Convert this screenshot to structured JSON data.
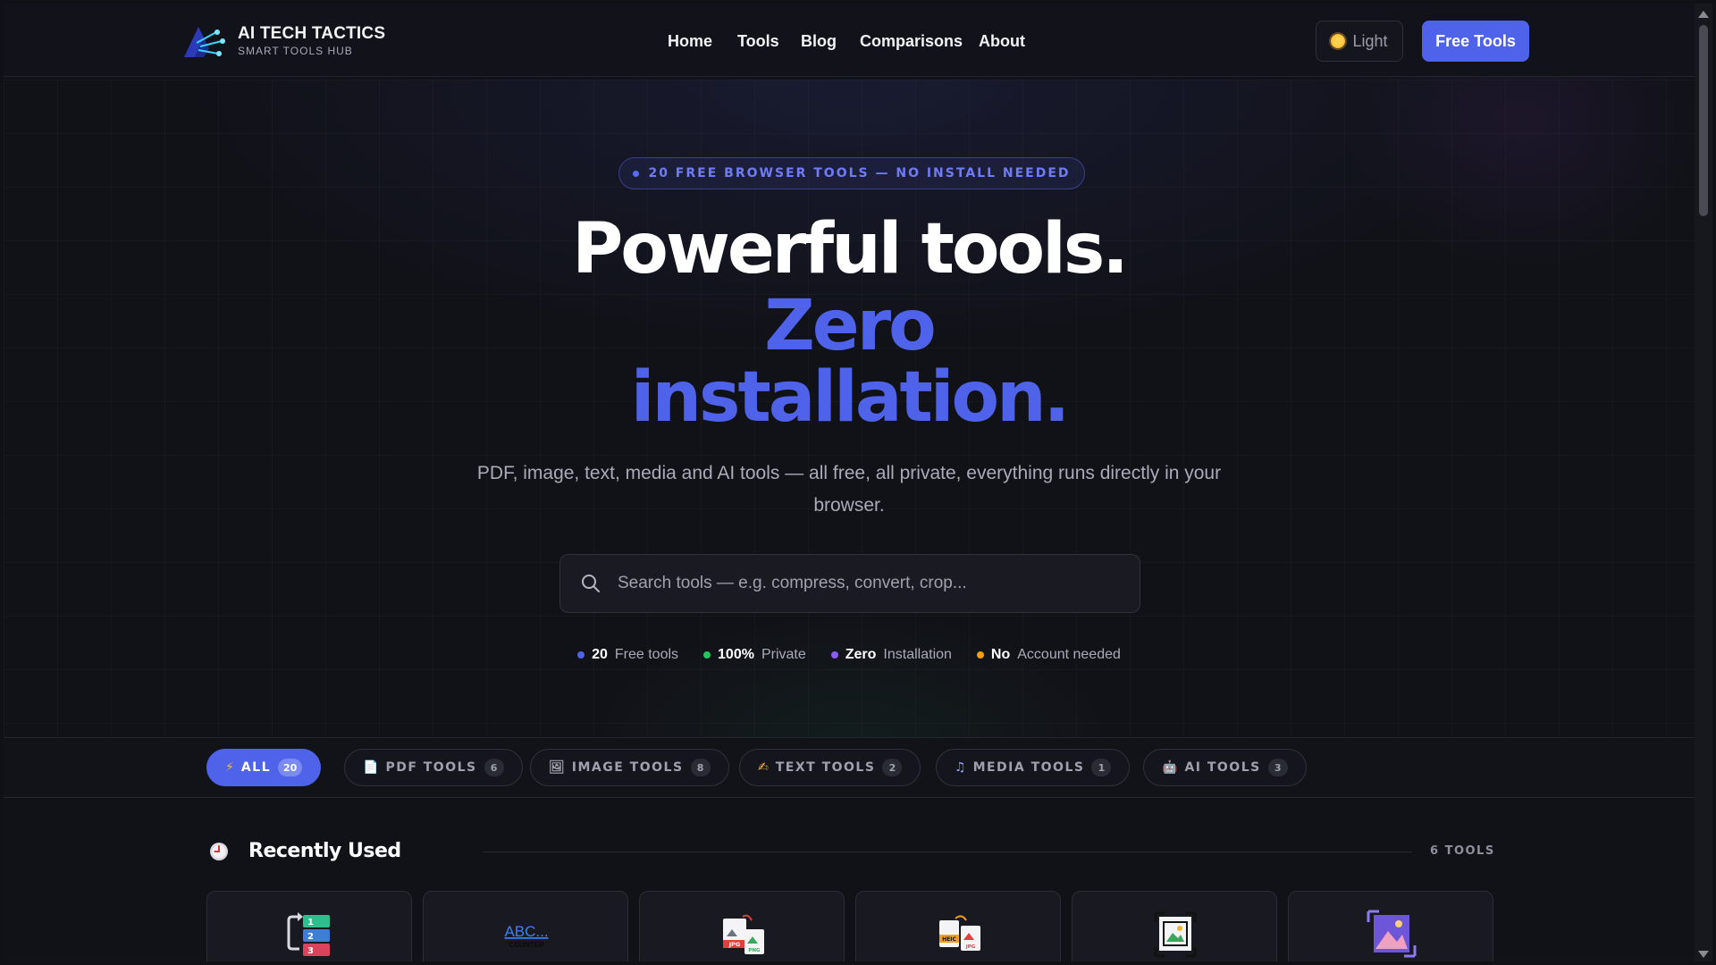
{
  "header": {
    "brand_title": "AI TECH TACTICS",
    "brand_subtitle": "SMART TOOLS HUB",
    "nav": [
      "Home",
      "Tools",
      "Blog",
      "Comparisons",
      "About"
    ],
    "theme_label": "Light",
    "cta_label": "Free Tools"
  },
  "hero": {
    "badge": "20 FREE BROWSER TOOLS — NO INSTALL NEEDED",
    "line1": "Powerful tools.",
    "line2": "Zero",
    "line3": "installation.",
    "description": "PDF, image, text, media and AI tools — all free, all private, everything runs directly in your browser.",
    "search_placeholder": "Search tools — e.g. compress, convert, crop...",
    "stats": [
      {
        "strong": "20",
        "text": "Free tools",
        "color": "#4f63ea"
      },
      {
        "strong": "100%",
        "text": "Private",
        "color": "#22c55e"
      },
      {
        "strong": "Zero",
        "text": "Installation",
        "color": "#8b5cf6"
      },
      {
        "strong": "No",
        "text": "Account needed",
        "color": "#f59e0b"
      }
    ]
  },
  "filters": [
    {
      "icon": "⚡",
      "label": "ALL",
      "count": "20",
      "active": true
    },
    {
      "icon": "📄",
      "label": "PDF TOOLS",
      "count": "6",
      "active": false
    },
    {
      "icon": "🖼",
      "label": "IMAGE TOOLS",
      "count": "8",
      "active": false
    },
    {
      "icon": "✍",
      "label": "TEXT TOOLS",
      "count": "2",
      "active": false
    },
    {
      "icon": "♫",
      "label": "MEDIA TOOLS",
      "count": "1",
      "active": false
    },
    {
      "icon": "🤖",
      "label": "AI TOOLS",
      "count": "3",
      "active": false
    }
  ],
  "recent": {
    "title": "Recently Used",
    "count": "6 TOOLS",
    "cards": [
      {
        "icon": "reorder-pages-icon"
      },
      {
        "icon": "word-counter-icon",
        "text": "ABC...",
        "subtext": "COUNTER"
      },
      {
        "icon": "jpg-to-png-icon",
        "text": "JPG",
        "subtext": "PNG"
      },
      {
        "icon": "heic-to-jpg-icon",
        "text": "HEIC",
        "subtext": "JPG"
      },
      {
        "icon": "image-crop-icon"
      },
      {
        "icon": "image-resize-icon"
      }
    ]
  },
  "colors": {
    "accent": "#4e63ea",
    "background": "#111218"
  }
}
